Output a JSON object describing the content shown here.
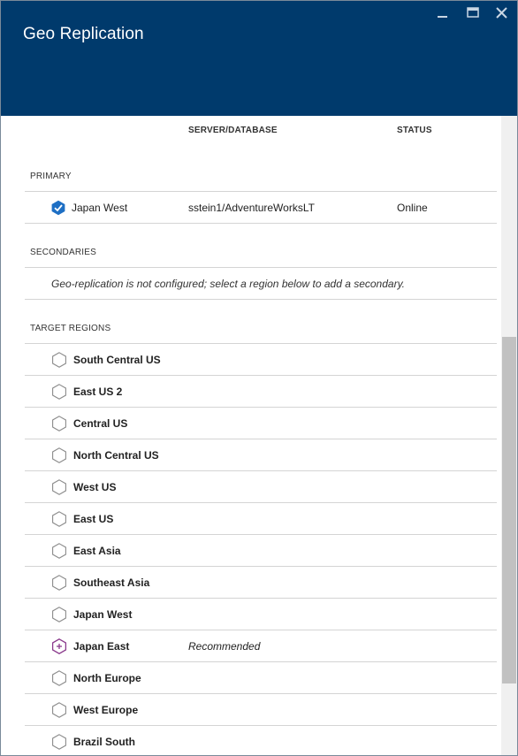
{
  "header": {
    "title": "Geo Replication",
    "controls": {
      "minimize": "minimize-icon",
      "maximize": "maximize-icon",
      "close": "close-icon"
    }
  },
  "columns": {
    "server_database": "SERVER/DATABASE",
    "status": "STATUS"
  },
  "primary": {
    "label": "PRIMARY",
    "region": "Japan West",
    "server_database": "sstein1/AdventureWorksLT",
    "status": "Online",
    "icon": "checkmark-hexagon-icon"
  },
  "secondaries": {
    "label": "SECONDARIES",
    "message": "Geo-replication is not configured; select a region below to add a secondary."
  },
  "target_regions": {
    "label": "TARGET REGIONS",
    "items": [
      {
        "name": "South Central US",
        "note": ""
      },
      {
        "name": "East US 2",
        "note": ""
      },
      {
        "name": "Central US",
        "note": ""
      },
      {
        "name": "North Central US",
        "note": ""
      },
      {
        "name": "West US",
        "note": ""
      },
      {
        "name": "East US",
        "note": ""
      },
      {
        "name": "East Asia",
        "note": ""
      },
      {
        "name": "Southeast Asia",
        "note": ""
      },
      {
        "name": "Japan West",
        "note": ""
      },
      {
        "name": "Japan East",
        "note": "Recommended",
        "recommended": true
      },
      {
        "name": "North Europe",
        "note": ""
      },
      {
        "name": "West Europe",
        "note": ""
      },
      {
        "name": "Brazil South",
        "note": ""
      }
    ]
  },
  "colors": {
    "header_bg": "#003a6c",
    "check_blue": "#1e6fc4",
    "recommended_purple": "#8a3a8c",
    "divider": "#d4d4d4"
  }
}
